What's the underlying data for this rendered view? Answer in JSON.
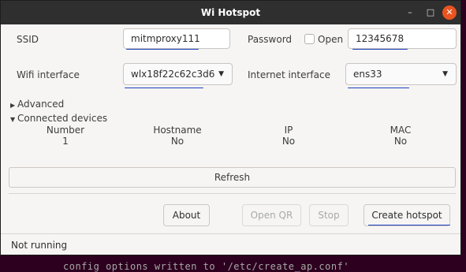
{
  "window": {
    "title": "Wi Hotspot",
    "controls": {
      "minimize": "–",
      "maximize": "□",
      "close": "✕"
    }
  },
  "ssid": {
    "label": "SSID",
    "value": "mitmproxy111"
  },
  "password": {
    "label": "Password",
    "open_label": "Open",
    "open_checked": false,
    "value": "12345678"
  },
  "wifi_interface": {
    "label": "Wifi interface",
    "value": "wlx18f22c62c3d6"
  },
  "internet_interface": {
    "label": "Internet interface",
    "value": "ens33"
  },
  "advanced": {
    "label": "Advanced",
    "expanded": false
  },
  "connected_devices": {
    "label": "Connected devices",
    "expanded": true,
    "columns": [
      "Number",
      "Hostname",
      "IP",
      "MAC"
    ],
    "rows": [
      [
        "1",
        "No",
        "No",
        "No"
      ]
    ]
  },
  "buttons": {
    "refresh": "Refresh",
    "about": "About",
    "open_qr": "Open QR",
    "stop": "Stop",
    "create_hotspot": "Create hotspot"
  },
  "status": "Not running",
  "background_terminal_text": "config options written to '/etc/create_ap.conf'",
  "colors": {
    "accent": "#e95420",
    "annotation": "#1b3fc0",
    "titlebar": "#2f2f2f"
  }
}
